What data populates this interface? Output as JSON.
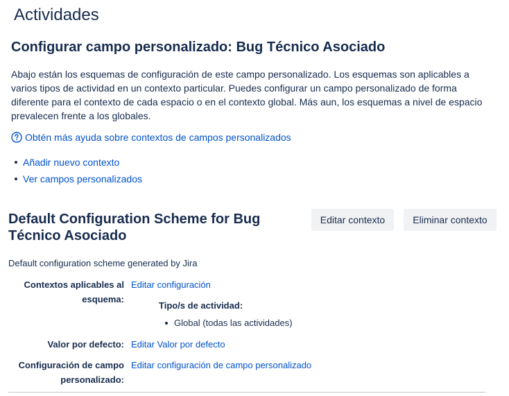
{
  "page": {
    "title": "Actividades",
    "section_title": "Configurar campo personalizado: Bug Técnico Asociado",
    "description": "Abajo están los esquemas de configuración de este campo personalizado. Los esquemas son aplicables a varios tipos de actividad en un contexto particular. Puedes configurar un campo personalizado de forma diferente para el contexto de cada espacio o en el contexto global. Más aun, los esquemas a nivel de espacio prevalecen frente a los globales.",
    "help_link": "Obtén más ayuda sobre contextos de campos personalizados",
    "help_icon": "question-circle-icon",
    "actions": [
      {
        "label": "Añadir nuevo contexto"
      },
      {
        "label": "Ver campos personalizados"
      }
    ]
  },
  "scheme": {
    "title": "Default Configuration Scheme for Bug Técnico Asociado",
    "edit_button": "Editar contexto",
    "delete_button": "Eliminar contexto",
    "description": "Default configuration scheme generated by Jira",
    "contexts_label": "Contextos aplicables al esquema:",
    "contexts_link": "Editar configuración",
    "issue_types_label": "Tipo/s de actividad:",
    "issue_types": [
      "Global (todas las actividades)"
    ],
    "default_label": "Valor por defecto:",
    "default_link": "Editar Valor por defecto",
    "config_label": "Configuración de campo personalizado:",
    "config_link": "Editar configuración de campo personalizado"
  },
  "colors": {
    "link": "#0052cc",
    "text": "#172b4d",
    "button_bg": "#f1f2f4"
  }
}
